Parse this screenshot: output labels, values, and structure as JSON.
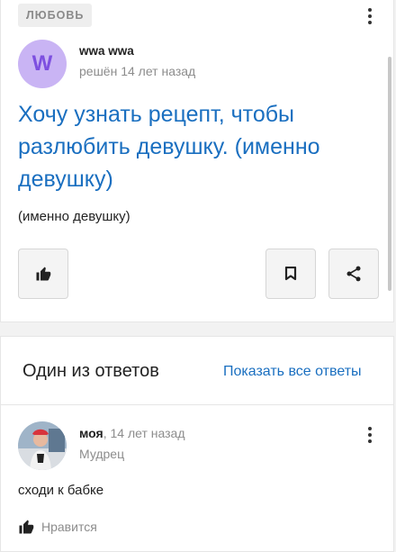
{
  "question": {
    "category": "ЛЮБОВЬ",
    "avatar_letter": "W",
    "author": "wwa wwa",
    "status": "решён 14 лет назад",
    "title": "Хочу узнать рецепт, чтобы разлюбить девушку. (именно девушку)",
    "body": "(именно девушку)",
    "icons": {
      "like": "thumbs-up-icon",
      "bookmark": "bookmark-icon",
      "share": "share-icon",
      "menu": "more-vertical-icon"
    }
  },
  "answers": {
    "heading": "Один из ответов",
    "show_all": "Показать все ответы",
    "item": {
      "author": "моя",
      "time": ", 14 лет назад",
      "rank": "Мудрец",
      "text": "сходи к бабке",
      "like_label": "Нравится"
    }
  },
  "colors": {
    "link": "#1a6fc0",
    "avatar_bg": "#c9b4f4",
    "avatar_fg": "#7d4fe0"
  }
}
